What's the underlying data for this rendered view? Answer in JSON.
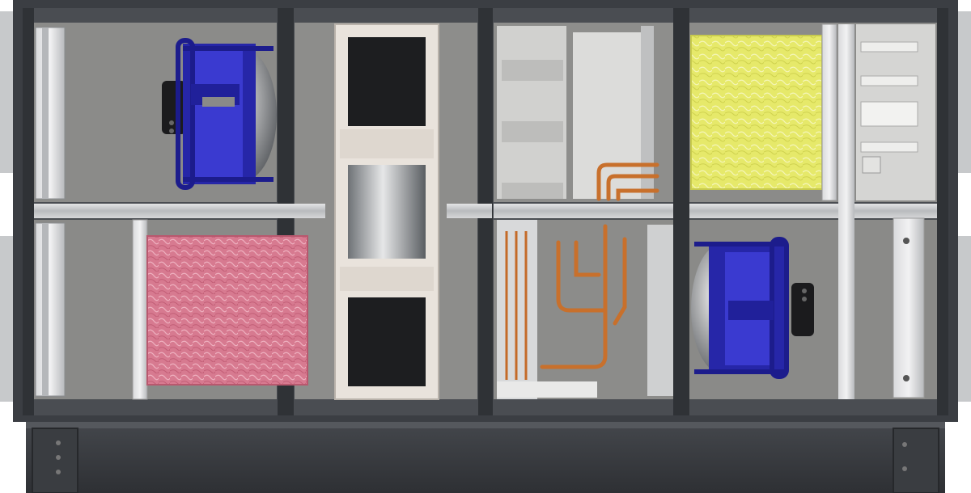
{
  "image": {
    "subject": "ahu-cutaway",
    "printed_text": []
  },
  "palette": {
    "frame_dark": "#3a3d42",
    "frame_mid": "#4a4e54",
    "panel_grey": "#8c8c8a",
    "rail_silver": "#c9cbcd",
    "fan_blue": "#1f1fa0",
    "fan_blue_light": "#3a3ad0",
    "filter_pink": "#d9788f",
    "filter_yellow": "#e8ea6a",
    "copper": "#c8702c",
    "panel_light": "#d8d8d6"
  }
}
